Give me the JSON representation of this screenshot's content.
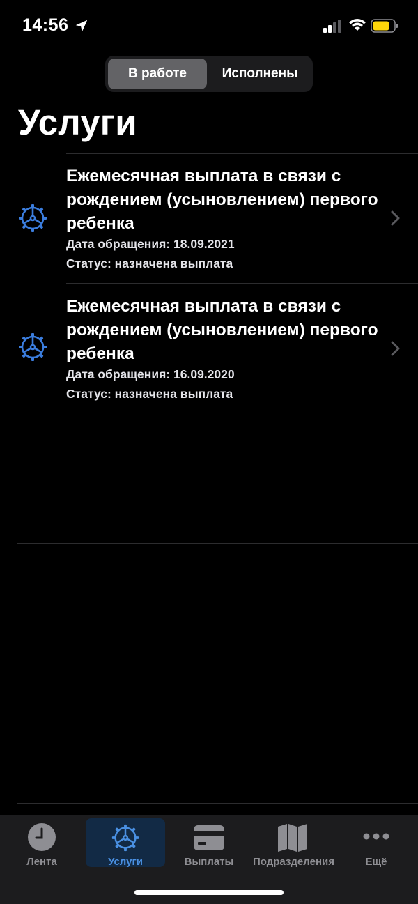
{
  "status_bar": {
    "time": "14:56"
  },
  "segments": [
    {
      "label": "В работе",
      "active": true
    },
    {
      "label": "Исполнены",
      "active": false
    }
  ],
  "page_title": "Услуги",
  "services": [
    {
      "title": "Ежемесячная выплата в связи с рождением (усыновлением) первого ребенка",
      "date": "Дата обращения: 18.09.2021",
      "status": "Статус: назначена выплата"
    },
    {
      "title": "Ежемесячная выплата в связи с рождением (усыновлением) первого ребенка",
      "date": "Дата обращения: 16.09.2020",
      "status": "Статус: назначена выплата"
    }
  ],
  "tabs": [
    {
      "label": "Лента",
      "icon": "clock-icon",
      "active": false
    },
    {
      "label": "Услуги",
      "icon": "gear-icon",
      "active": true
    },
    {
      "label": "Выплаты",
      "icon": "card-icon",
      "active": false
    },
    {
      "label": "Подразделения",
      "icon": "map-icon",
      "active": false
    },
    {
      "label": "Ещё",
      "icon": "more-dots-icon",
      "active": false
    }
  ],
  "colors": {
    "accent": "#4a90e2",
    "background": "#000000",
    "tab_bar": "#1c1c1e"
  }
}
